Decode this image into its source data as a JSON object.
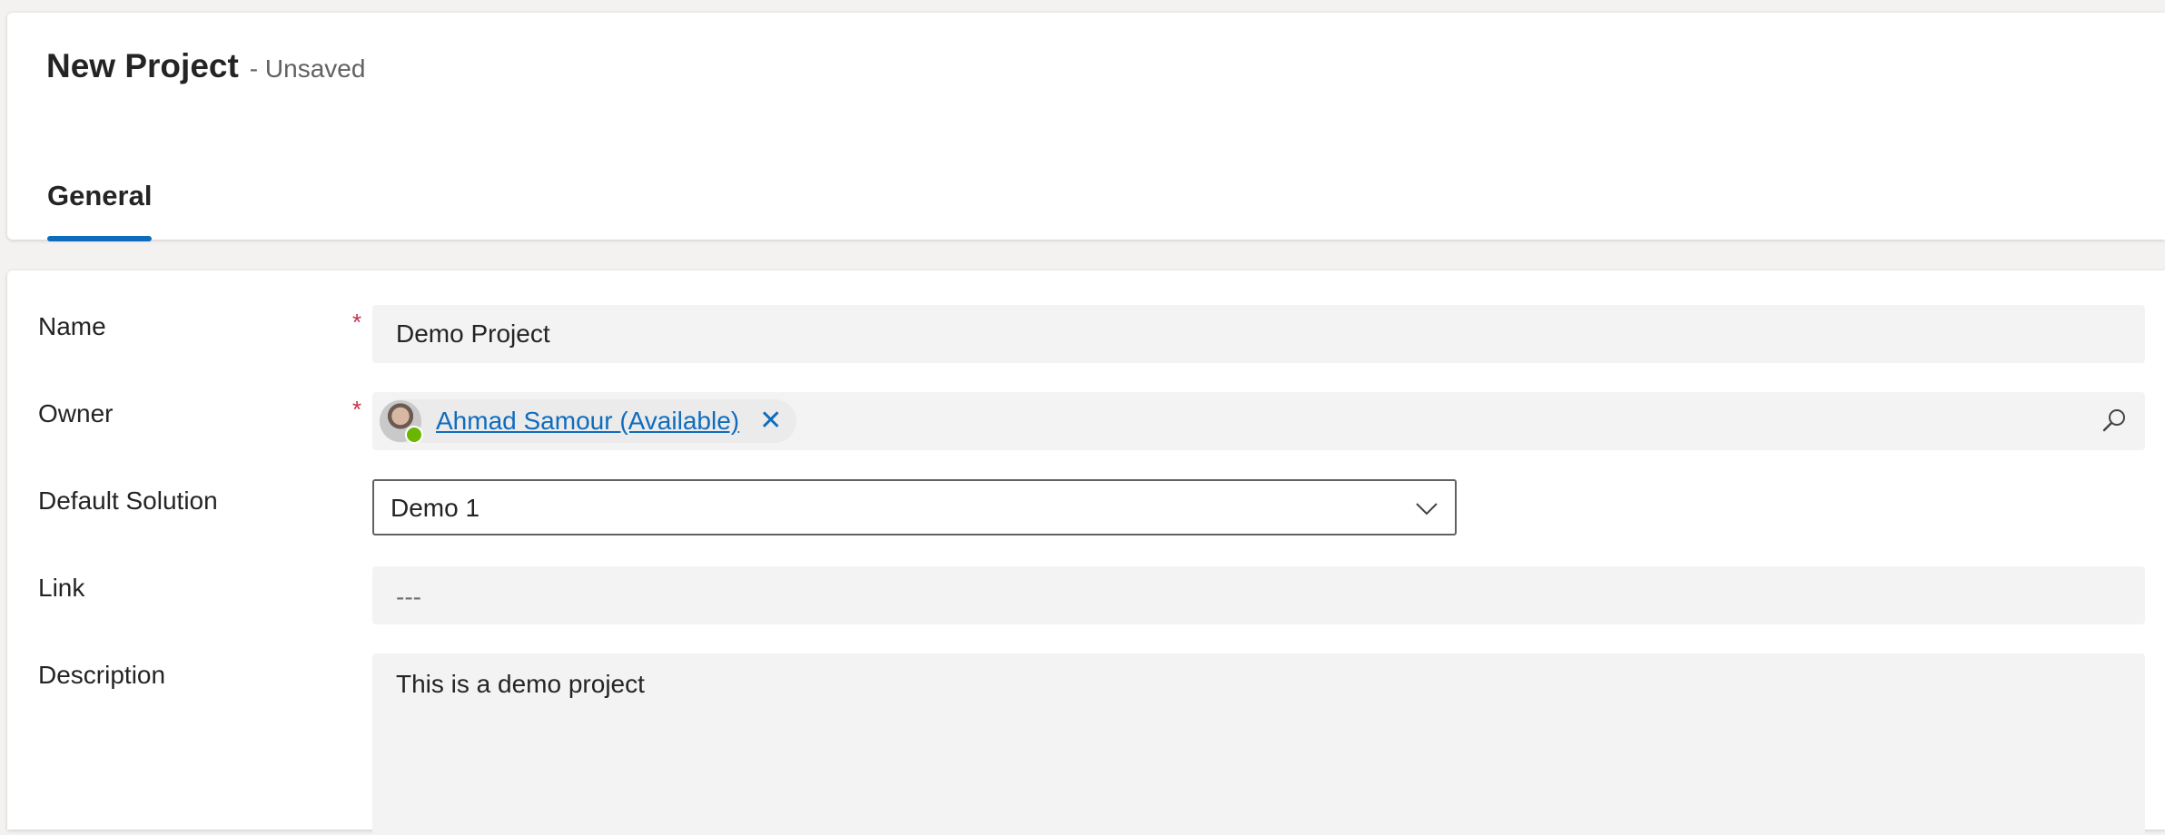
{
  "header": {
    "title": "New Project",
    "status": "- Unsaved"
  },
  "tabs": [
    {
      "label": "General",
      "active": true
    }
  ],
  "form": {
    "name": {
      "label": "Name",
      "required_marker": "*",
      "value": "Demo Project"
    },
    "owner": {
      "label": "Owner",
      "required_marker": "*",
      "value": "Ahmad Samour (Available)",
      "remove_glyph": "✕",
      "presence_color": "#6bb700",
      "lookup_icon": "search-icon"
    },
    "default_solution": {
      "label": "Default Solution",
      "value": "Demo 1",
      "dropdown_icon": "chevron-down-icon"
    },
    "link": {
      "label": "Link",
      "value": "---"
    },
    "description": {
      "label": "Description",
      "value": "This is a demo project"
    }
  },
  "colors": {
    "accent": "#0f6cbd",
    "required": "#c4314b",
    "field_background": "#f3f3f3"
  }
}
